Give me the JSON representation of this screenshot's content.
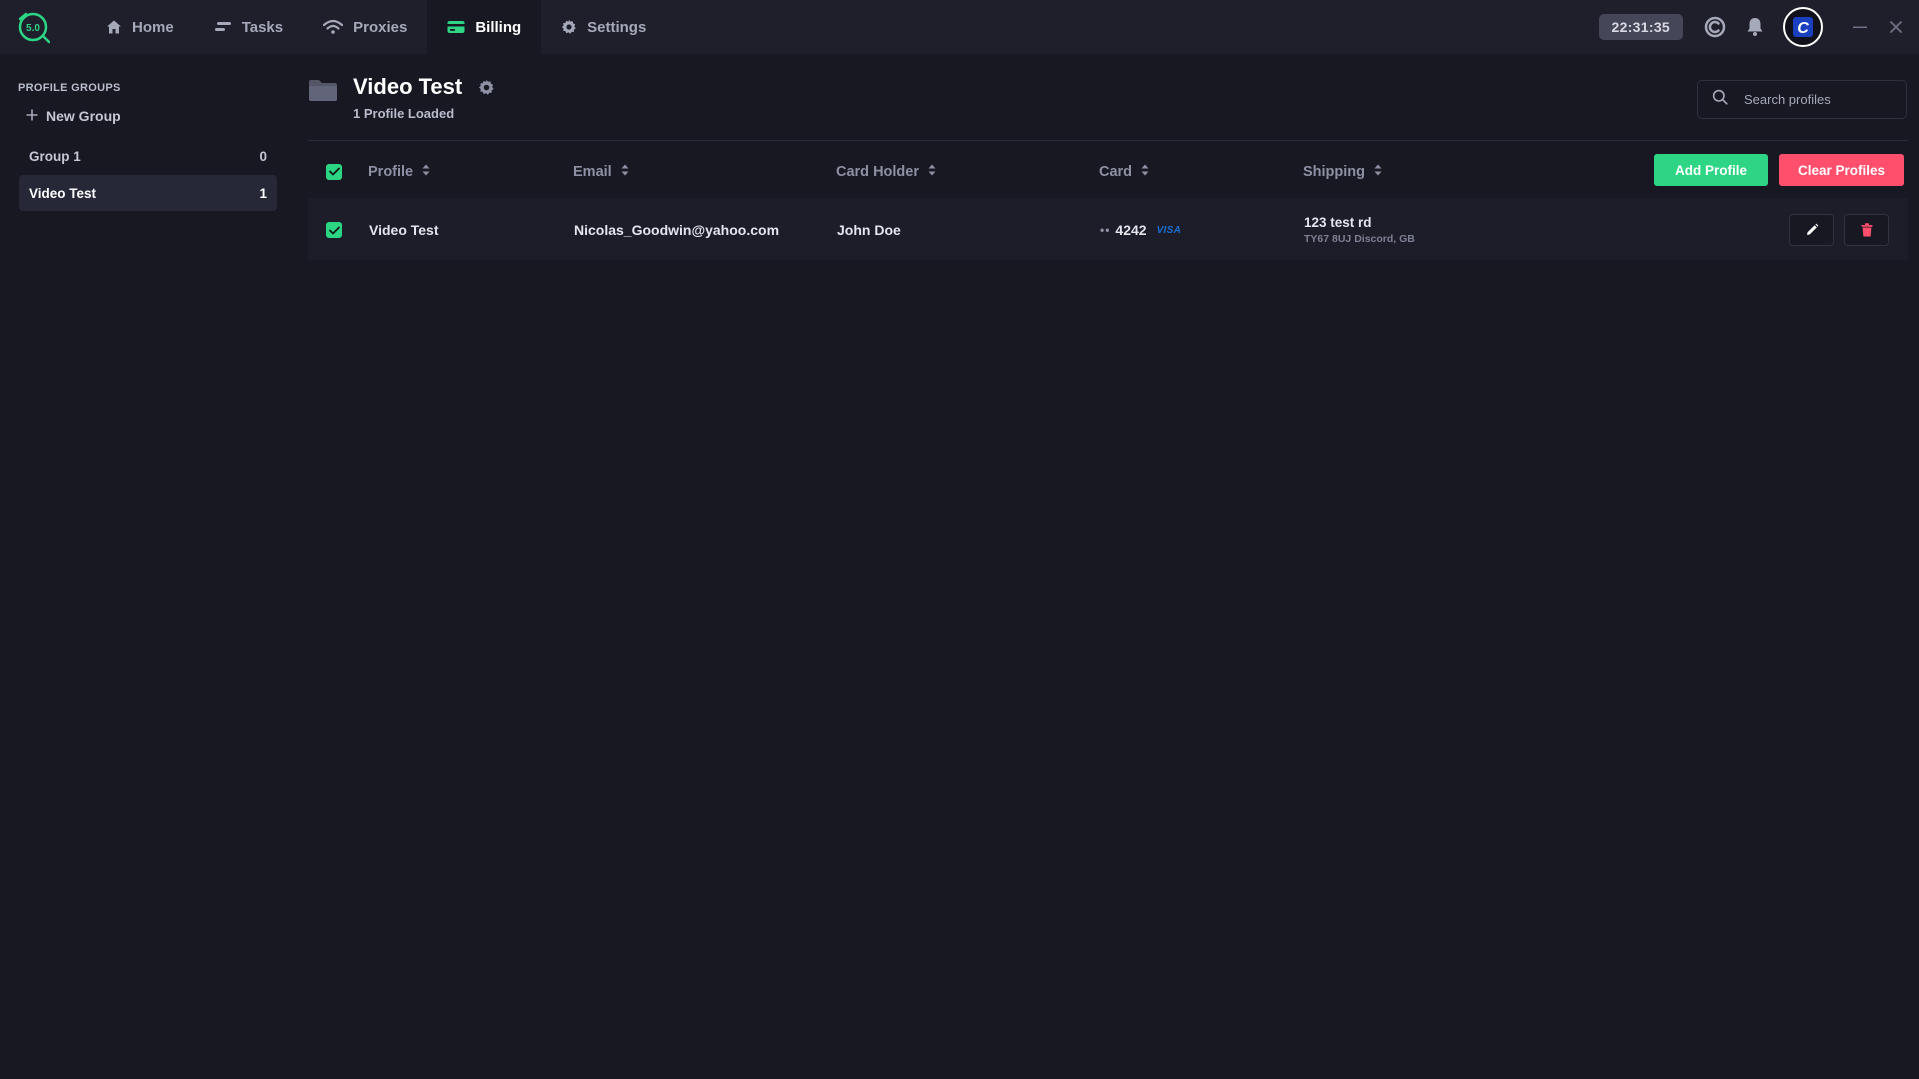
{
  "app": {
    "logo_text": "5.0"
  },
  "nav": [
    {
      "label": "Home",
      "icon": "home-icon"
    },
    {
      "label": "Tasks",
      "icon": "tasks-icon"
    },
    {
      "label": "Proxies",
      "icon": "wifi-icon"
    },
    {
      "label": "Billing",
      "icon": "billing-card-icon",
      "active": true
    },
    {
      "label": "Settings",
      "icon": "gear-icon"
    }
  ],
  "topbar": {
    "clock": "22:31:35",
    "avatar_letter": "C"
  },
  "sidebar": {
    "title": "PROFILE GROUPS",
    "new_group_label": "New Group",
    "groups": [
      {
        "name": "Group 1",
        "count": "0"
      },
      {
        "name": "Video Test",
        "count": "1",
        "active": true
      }
    ]
  },
  "main": {
    "title": "Video Test",
    "subtitle": "1 Profile Loaded",
    "search": {
      "placeholder": "Search profiles",
      "value": ""
    }
  },
  "table": {
    "columns": [
      "Profile",
      "Email",
      "Card Holder",
      "Card",
      "Shipping"
    ],
    "add_label": "Add Profile",
    "clear_label": "Clear Profiles",
    "rows": [
      {
        "profile": "Video Test",
        "email": "Nicolas_Goodwin@yahoo.com",
        "card_holder": "John Doe",
        "card_dots": "••",
        "card_last4": "4242",
        "card_brand": "VISA",
        "shipping_line1": "123 test rd",
        "shipping_line2": "TY67 8UJ Discord, GB"
      }
    ]
  },
  "colors": {
    "background": "#171822",
    "topbar": "#1e1f2b",
    "accent_green": "#2dd584",
    "danger_red": "#ff4f6d"
  }
}
